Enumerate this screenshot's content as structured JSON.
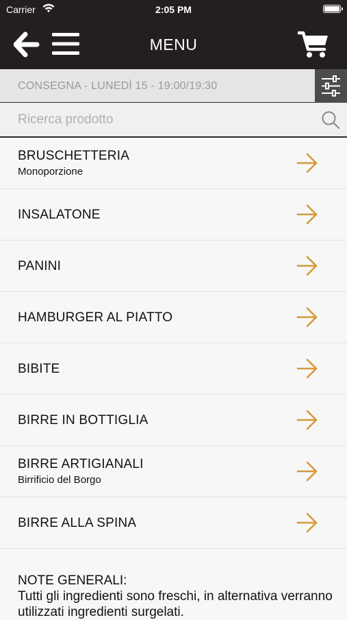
{
  "status_bar": {
    "carrier": "Carrier",
    "time": "2:05 PM"
  },
  "navbar": {
    "title": "MENU",
    "icons": {
      "back": "back-arrow-icon",
      "menu": "hamburger-menu-icon",
      "cart": "shopping-cart-icon"
    }
  },
  "delivery": {
    "text": "CONSEGNA - LUNEDÌ 15 - 19:00/19:30",
    "filter_icon": "sliders-icon"
  },
  "search": {
    "placeholder": "Ricerca prodotto",
    "value": ""
  },
  "categories": [
    {
      "name": "BRUSCHETTERIA",
      "subtitle": "Monoporzione"
    },
    {
      "name": "INSALATONE",
      "subtitle": ""
    },
    {
      "name": "PANINI",
      "subtitle": ""
    },
    {
      "name": "HAMBURGER AL PIATTO",
      "subtitle": ""
    },
    {
      "name": "BIBITE",
      "subtitle": ""
    },
    {
      "name": "BIRRE IN BOTTIGLIA",
      "subtitle": ""
    },
    {
      "name": "BIRRE ARTIGIANALI",
      "subtitle": "Birrificio del Borgo"
    },
    {
      "name": "BIRRE ALLA SPINA",
      "subtitle": ""
    }
  ],
  "notes": {
    "title": "NOTE GENERALI:",
    "body": "Tutti gli ingredienti sono freschi, in alternativa verranno utilizzati ingredienti surgelati."
  },
  "colors": {
    "header_bg": "#231f1e",
    "accent": "#d39a3b",
    "filter_bg": "#4c4c4c"
  }
}
